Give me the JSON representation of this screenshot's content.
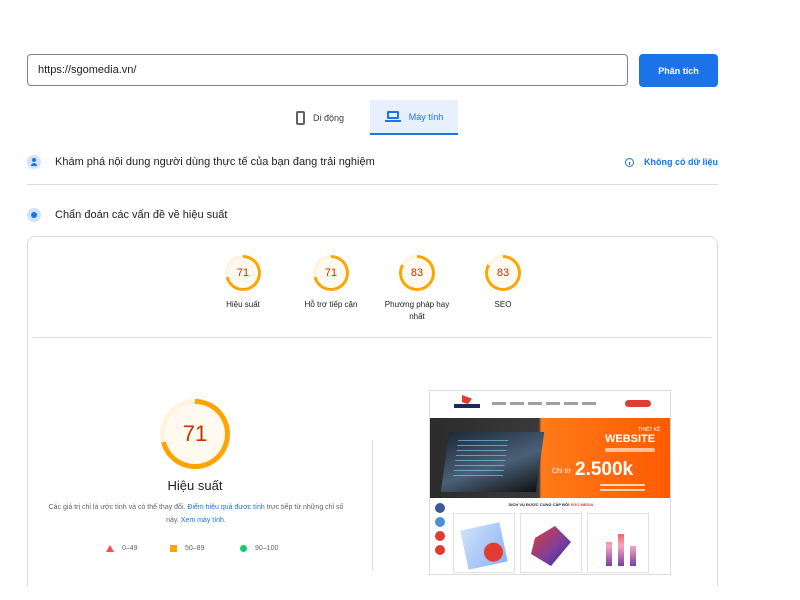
{
  "search": {
    "url_value": "https://sgomedia.vn/",
    "analyze_label": "Phân tích"
  },
  "device_tabs": {
    "mobile_label": "Di động",
    "desktop_label": "Máy tính",
    "selected": "desktop"
  },
  "field_data": {
    "title": "Khám phá nội dung người dùng thực tế của bạn đang trải nghiệm",
    "status_label": "Không có dữ liệu"
  },
  "diagnostics": {
    "title": "Chẩn đoán các vấn đề về hiệu suất"
  },
  "scores": [
    {
      "label": "Hiệu suất",
      "value": "71"
    },
    {
      "label": "Hỗ trợ tiếp cận",
      "value": "71"
    },
    {
      "label": "Phương pháp hay nhất",
      "value": "83"
    },
    {
      "label": "SEO",
      "value": "83"
    }
  ],
  "performance": {
    "score": "71",
    "title": "Hiệu suất",
    "disclaimer_prefix": "Các giá trị chỉ là ước tính và có thể thay đổi.",
    "disclaimer_link": "Điểm hiệu quả được tính",
    "disclaimer_middle": "trực tiếp từ những chỉ số này.",
    "disclaimer_link2": "Xem máy tính."
  },
  "legend": [
    {
      "range": "0–49",
      "color": "#ff4e42"
    },
    {
      "range": "50–89",
      "color": "#ffa400"
    },
    {
      "range": "90–100",
      "color": "#0cce6b"
    }
  ],
  "screenshot": {
    "banner_small": "THIẾT KẾ",
    "banner_big": "WEBSITE",
    "price_prefix": "Chỉ từ",
    "price": "2.500k",
    "services_heading": "DỊCH VỤ ĐƯỢC CUNG CẤP BỞI",
    "services_brand": "SGO MEDIA"
  },
  "colors": {
    "accent": "#1a73e8",
    "score_average": "#ffa400",
    "score_text": "#c33300"
  }
}
